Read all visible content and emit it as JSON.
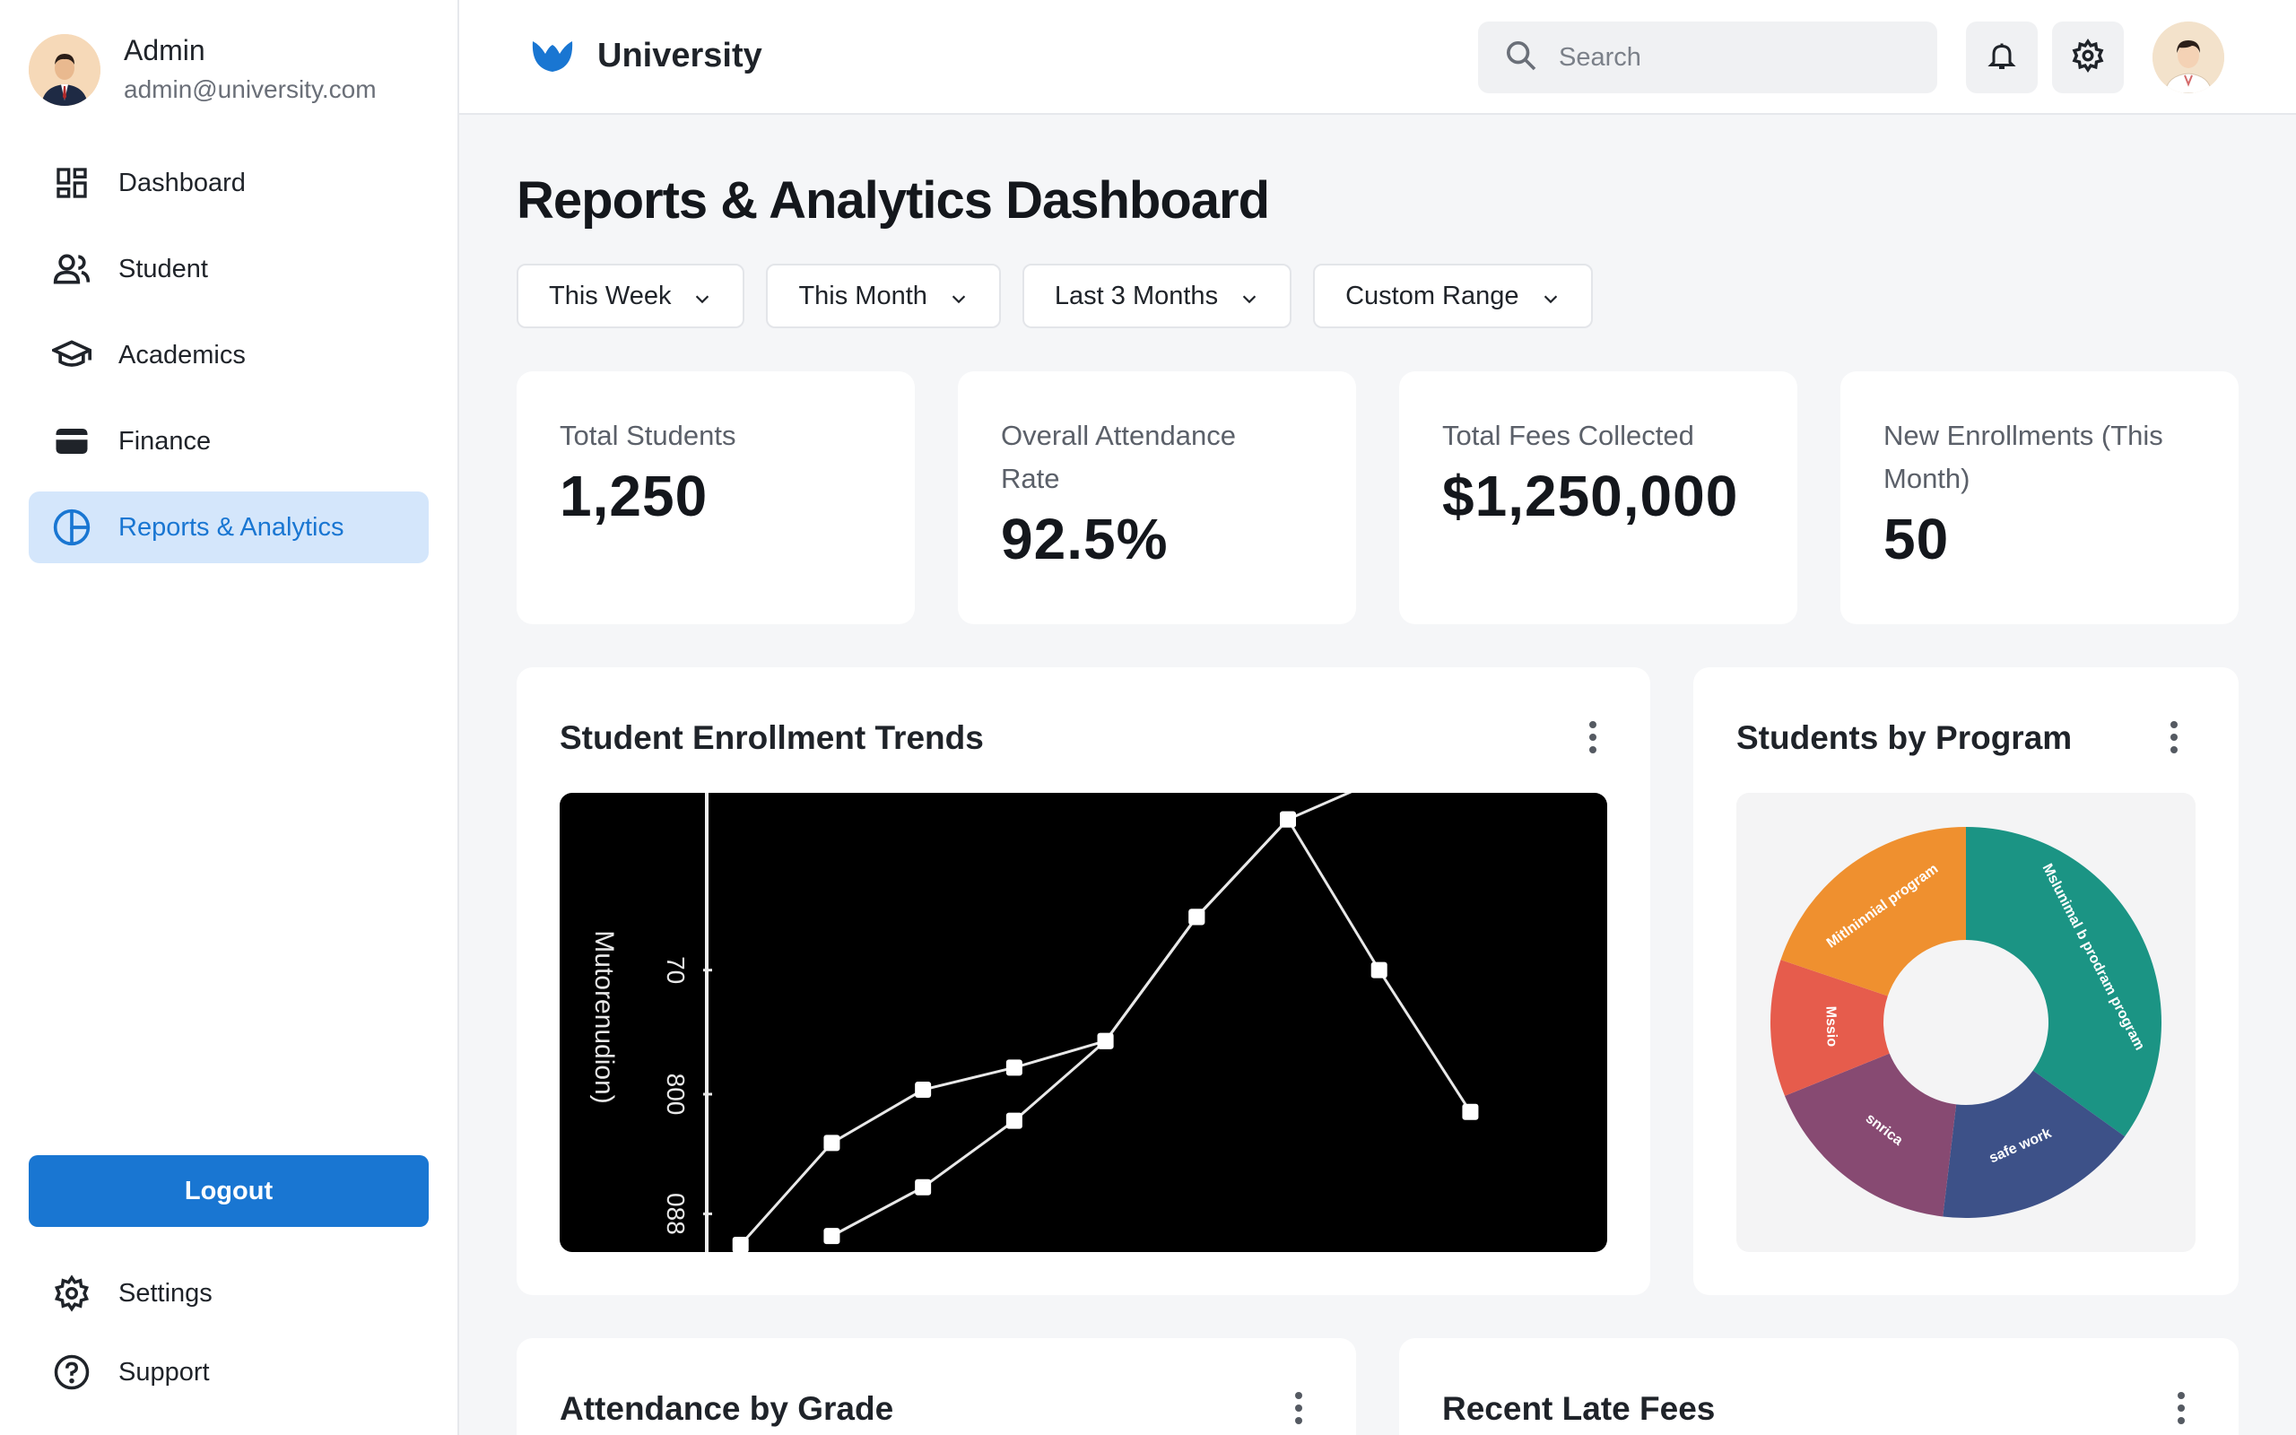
{
  "profile": {
    "name": "Admin",
    "email": "admin@university.com"
  },
  "sidebar": {
    "items": [
      {
        "label": "Dashboard",
        "icon": "dashboard-icon"
      },
      {
        "label": "Student",
        "icon": "users-icon"
      },
      {
        "label": "Academics",
        "icon": "graduation-cap-icon"
      },
      {
        "label": "Finance",
        "icon": "wallet-icon"
      },
      {
        "label": "Reports & Analytics",
        "icon": "pie-chart-icon",
        "active": true
      }
    ],
    "logout_label": "Logout",
    "bottom": [
      {
        "label": "Settings",
        "icon": "gear-icon"
      },
      {
        "label": "Support",
        "icon": "help-icon"
      }
    ]
  },
  "header": {
    "brand": "University",
    "search_placeholder": "Search"
  },
  "page": {
    "title": "Reports & Analytics Dashboard",
    "filters": [
      "This Week",
      "This Month",
      "Last 3 Months",
      "Custom Range"
    ]
  },
  "stats": [
    {
      "label": "Total Students",
      "value": "1,250"
    },
    {
      "label": "Overall Attendance Rate",
      "value": "92.5%"
    },
    {
      "label": "Total Fees Collected",
      "value": "$1,250,000"
    },
    {
      "label": "New Enrollments (This Month)",
      "value": "50"
    }
  ],
  "cards": {
    "enrollment_title": "Student Enrollment Trends",
    "program_title": "Students by Program",
    "attendance_title": "Attendance by Grade",
    "latefees_title": "Recent Late Fees"
  },
  "chart_data": [
    {
      "type": "line",
      "ylabel": "Mutorenudion)",
      "y_tick_labels": [
        "088",
        "800",
        "70"
      ],
      "series": [
        {
          "points": [
            [
              1,
              0.0
            ],
            [
              2,
              0.23
            ],
            [
              3,
              0.35
            ],
            [
              4,
              0.4
            ],
            [
              5,
              0.46
            ],
            [
              6,
              0.74
            ],
            [
              7,
              0.96
            ],
            [
              8,
              1.05
            ]
          ]
        },
        {
          "points": [
            [
              2,
              0.02
            ],
            [
              3,
              0.13
            ],
            [
              4,
              0.28
            ],
            [
              5,
              0.46
            ],
            [
              6,
              0.74
            ],
            [
              7,
              0.96
            ],
            [
              8,
              0.62
            ],
            [
              9,
              0.3
            ]
          ]
        }
      ],
      "colors": {
        "background": "#000000",
        "line": "#e8e8e8"
      }
    },
    {
      "type": "pie",
      "slices": [
        {
          "label": "Mslunimal b prodram program",
          "value": 37,
          "color": "#1b9484"
        },
        {
          "label": "safe work",
          "value": 18,
          "color": "#3d5188"
        },
        {
          "label": "snrica",
          "value": 18,
          "color": "#874a72"
        },
        {
          "label": "Mssio",
          "value": 12,
          "color": "#e65c4c"
        },
        {
          "label": "Mitlninnial program",
          "value": 21,
          "color": "#ef902f"
        }
      ]
    }
  ],
  "colors": {
    "accent": "#1976d2",
    "active_bg": "#d4e6fb"
  }
}
